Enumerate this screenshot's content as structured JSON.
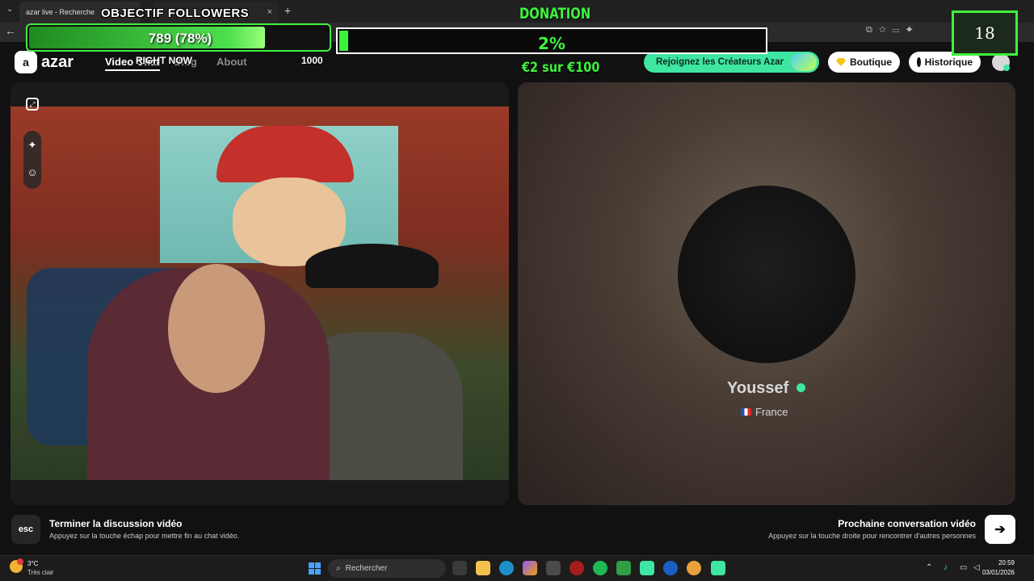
{
  "browser": {
    "active_tab_title": "azar live - Recherche",
    "tab_close": "×",
    "new_tab": "+"
  },
  "site": {
    "logo_text": "azar",
    "nav": {
      "video_chat": "Video Chat",
      "blog": "Blog",
      "about": "About"
    },
    "creators_button": "Rejoignez les Créateurs Azar",
    "boutique_button": "Boutique",
    "history_button": "Historique"
  },
  "peer": {
    "name": "Youssef",
    "country": "France"
  },
  "controls": {
    "esc_key": "esc",
    "end_title": "Terminer la discussion vidéo",
    "end_sub": "Appuyez sur la touche échap pour mettre fin au chat vidéo.",
    "next_title": "Prochaine conversation vidéo",
    "next_sub": "Appuyez sur la touche droite pour rencontrer d'autres personnes"
  },
  "overlay": {
    "followers_label": "OBJECTIF FOLLOWERS",
    "followers_value": "789 (78%)",
    "followers_progress": 0.789,
    "right_now": "RIGHT NOW",
    "goal_count": "1000",
    "donation_label": "DONATION",
    "donation_pct": "2%",
    "donation_progress": 0.02,
    "donation_amount": "€2 sur €100",
    "age_badge": "18"
  },
  "taskbar": {
    "temperature": "3°C",
    "weather": "Très clair",
    "search_placeholder": "Rechercher",
    "time": "20:59",
    "date": "03/01/2026"
  },
  "colors": {
    "accent_green": "#3df23d",
    "azar_mint": "#3ee6a2"
  }
}
